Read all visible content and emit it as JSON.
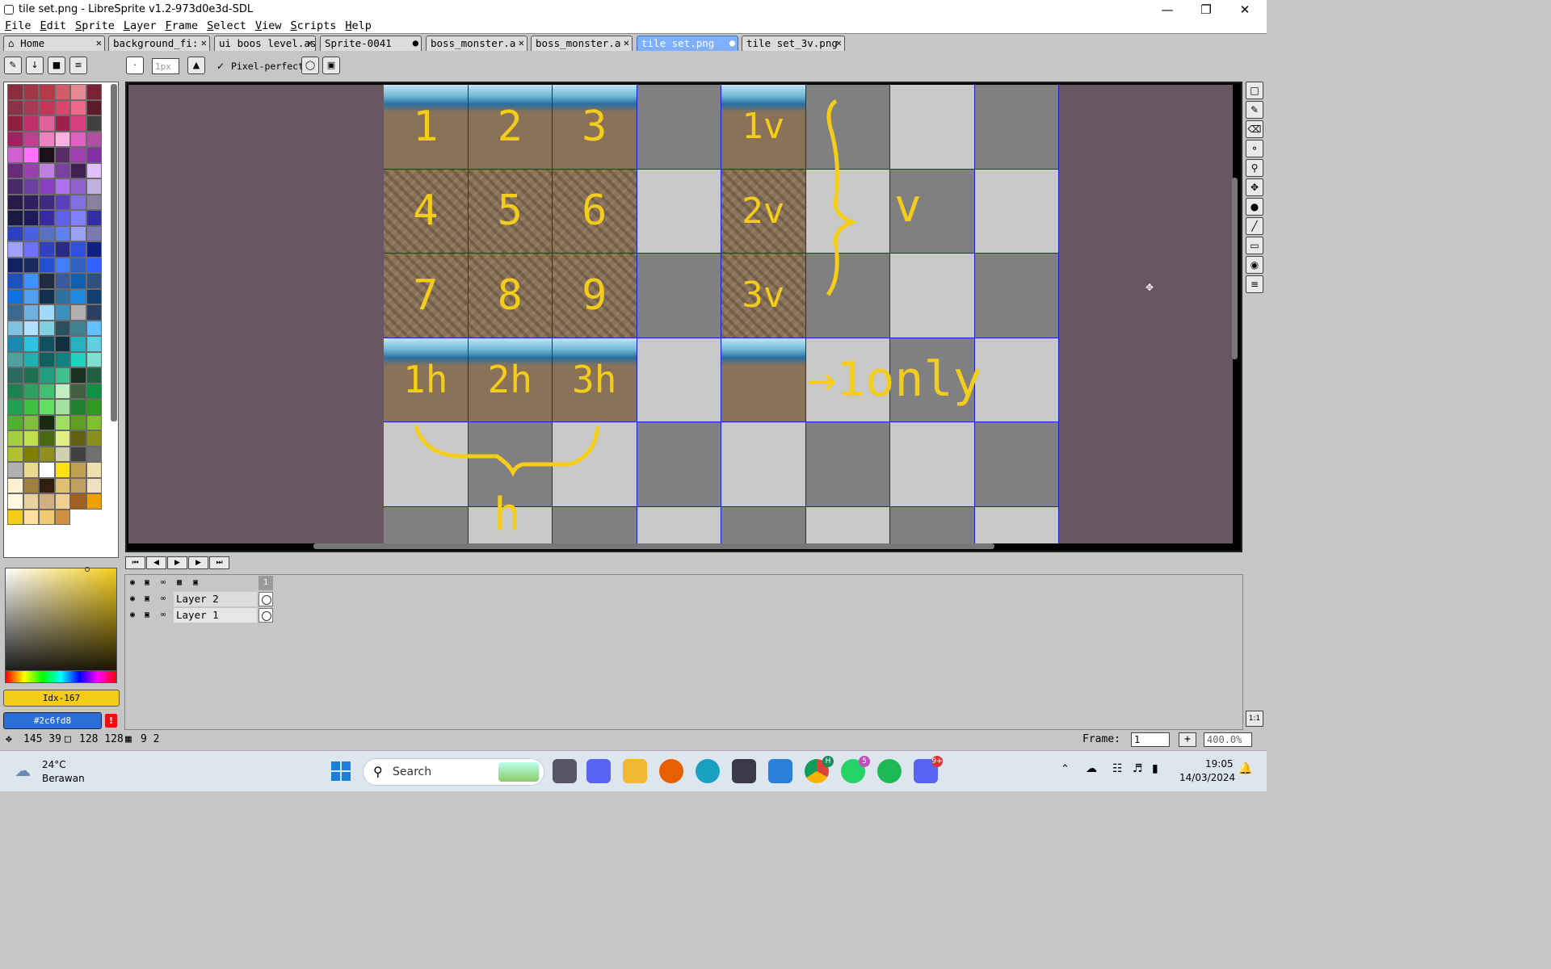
{
  "window": {
    "title": "tile set.png - LibreSprite v1.2-973d0e3d-SDL"
  },
  "menu": [
    "File",
    "Edit",
    "Sprite",
    "Layer",
    "Frame",
    "Select",
    "View",
    "Scripts",
    "Help"
  ],
  "tabs": [
    {
      "label": "Home",
      "closable": true
    },
    {
      "label": "background_fi:",
      "closable": true
    },
    {
      "label": "ui boos level.as",
      "closable": true
    },
    {
      "label": "Sprite-0041",
      "modified": true
    },
    {
      "label": "boss_monster.a",
      "closable": true
    },
    {
      "label": "boss_monster.a",
      "closable": true
    },
    {
      "label": "tile set.png",
      "modified": true,
      "active": true
    },
    {
      "label": "tile set_3v.png",
      "closable": true
    }
  ],
  "toolbar": {
    "brush_size": "1px",
    "pixel_perfect": "Pixel-perfect"
  },
  "palette": {
    "colors": [
      "#8b2c3f",
      "#a03646",
      "#b73a48",
      "#d25c6a",
      "#e58a92",
      "#7a2233",
      "#8a3346",
      "#a53a55",
      "#c23758",
      "#d9456c",
      "#ee6a8b",
      "#5b1c2a",
      "#902040",
      "#c0306a",
      "#e0609b",
      "#a01e4b",
      "#d73f7f",
      "#404040",
      "#a02060",
      "#c04090",
      "#f080c0",
      "#ffb0e0",
      "#e060c0",
      "#b050a0",
      "#d060d0",
      "#ff70ff",
      "#1a0f1a",
      "#5a2a6a",
      "#a040b0",
      "#8030a0",
      "#6a2a7a",
      "#9a40b0",
      "#c080e0",
      "#7a40a0",
      "#402050",
      "#e0c0ff",
      "#4a2a6a",
      "#6a40a0",
      "#8a40c0",
      "#b070f0",
      "#9060d0",
      "#c0b0e0",
      "#2a1a4a",
      "#302060",
      "#402a80",
      "#5a40c0",
      "#8070e0",
      "#8a80a0",
      "#1a1a40",
      "#201a5a",
      "#3a2aa0",
      "#6060f0",
      "#8080ff",
      "#3030a0",
      "#2a40c0",
      "#4a60e0",
      "#5a70c0",
      "#6080f0",
      "#9aa0f0",
      "#7a7ab0",
      "#a0a0ff",
      "#7070ff",
      "#3040c0",
      "#2a2a8a",
      "#3050e0",
      "#102080",
      "#102060",
      "#1a2a60",
      "#2050d0",
      "#4080ff",
      "#3060c0",
      "#3060ff",
      "#2050c0",
      "#4090ff",
      "#202a40",
      "#3a5aa0",
      "#1060b0",
      "#305080",
      "#1070e0",
      "#50a0f0",
      "#103050",
      "#3070a0",
      "#208ae0",
      "#104070",
      "#3a6a90",
      "#70b0e0",
      "#a0d8ff",
      "#3a90c0",
      "#b0b0b0",
      "#2a4060",
      "#80c0e0",
      "#b0e0ff",
      "#80d0e0",
      "#2a5060",
      "#408090",
      "#60c0ff",
      "#1a8ab0",
      "#30c0e0",
      "#105060",
      "#103040",
      "#2ab0c0",
      "#60d0e0",
      "#50a0a0",
      "#20b0b0",
      "#106060",
      "#108080",
      "#20d0c0",
      "#80e0d0",
      "#2a6a60",
      "#207050",
      "#20a080",
      "#40c090",
      "#1a3020",
      "#206040",
      "#208050",
      "#30a060",
      "#40c070",
      "#c0f0c0",
      "#406040",
      "#109040",
      "#20a050",
      "#40c040",
      "#60e060",
      "#a0e0a0",
      "#208030",
      "#309a20",
      "#50b030",
      "#80c040",
      "#1a2a10",
      "#a0e060",
      "#60a020",
      "#80c030",
      "#a0d040",
      "#c0e050",
      "#4a6a10",
      "#e0f080",
      "#606010",
      "#8a9020",
      "#b0c030",
      "#808000",
      "#909020",
      "#d0d0b0",
      "#404040",
      "#707070",
      "#b0b0b0",
      "#e8d890",
      "#ffffff",
      "#ffe010",
      "#c0a050",
      "#f0e0b0",
      "#fff0d0",
      "#a08040",
      "#302010",
      "#e0c070",
      "#c0a060",
      "#f0e0c0",
      "#fff8e0",
      "#e8d0a0",
      "#d0b080",
      "#f0d090",
      "#a06020",
      "#f0a000",
      "#f4cc1a",
      "#ffe0a0",
      "#f0c870",
      "#d09040"
    ],
    "fg": "Idx-167",
    "bg": "#2c6fd8"
  },
  "canvas": {
    "numbers": [
      [
        "1",
        "2",
        "3"
      ],
      [
        "4",
        "5",
        "6"
      ],
      [
        "7",
        "8",
        "9"
      ],
      [
        "1h",
        "2h",
        "3h"
      ]
    ],
    "vcol": [
      "1v",
      "2v",
      "3v"
    ],
    "notes": [
      "v",
      "→1only",
      "h"
    ]
  },
  "layers": [
    {
      "name": "Layer 2"
    },
    {
      "name": "Layer 1"
    }
  ],
  "timeline": {
    "frame_header": "1"
  },
  "status": {
    "cursor": "145 39",
    "size": "128 128",
    "grid": "9 2",
    "frame_label": "Frame:",
    "frame_value": "1",
    "zoom": "400.0%"
  },
  "taskbar": {
    "weather_temp": "24°C",
    "weather_desc": "Berawan",
    "search": "Search",
    "time": "19:05",
    "date": "14/03/2024",
    "whatsapp_badge": "5",
    "discord_badge": "9+",
    "chrome_badge": "H"
  }
}
